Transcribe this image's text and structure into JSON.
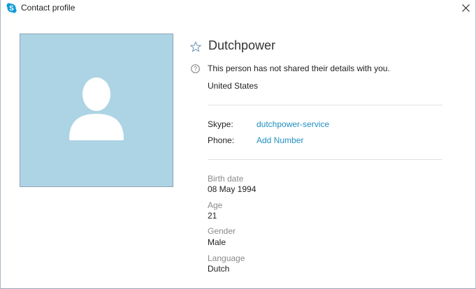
{
  "window": {
    "title": "Contact profile",
    "app_icon": "skype-icon",
    "close_icon": "close-icon"
  },
  "profile": {
    "name": "Dutchpower",
    "notice": "This person has not shared their details with you.",
    "location": "United States",
    "favorite_icon": "star-outline-icon",
    "info_icon": "help-circle-icon",
    "avatar_icon": "default-person-icon"
  },
  "contact": {
    "skype_label": "Skype:",
    "skype_value": "dutchpower-service",
    "phone_label": "Phone:",
    "phone_value": "Add Number"
  },
  "details": [
    {
      "label": "Birth date",
      "value": "08 May 1994"
    },
    {
      "label": "Age",
      "value": "21"
    },
    {
      "label": "Gender",
      "value": "Male"
    },
    {
      "label": "Language",
      "value": "Dutch"
    }
  ],
  "colors": {
    "avatar_bg": "#add4e4",
    "link": "#1f8fbf",
    "skype_blue": "#0f9bd7",
    "muted_label": "#8a8a8a"
  }
}
